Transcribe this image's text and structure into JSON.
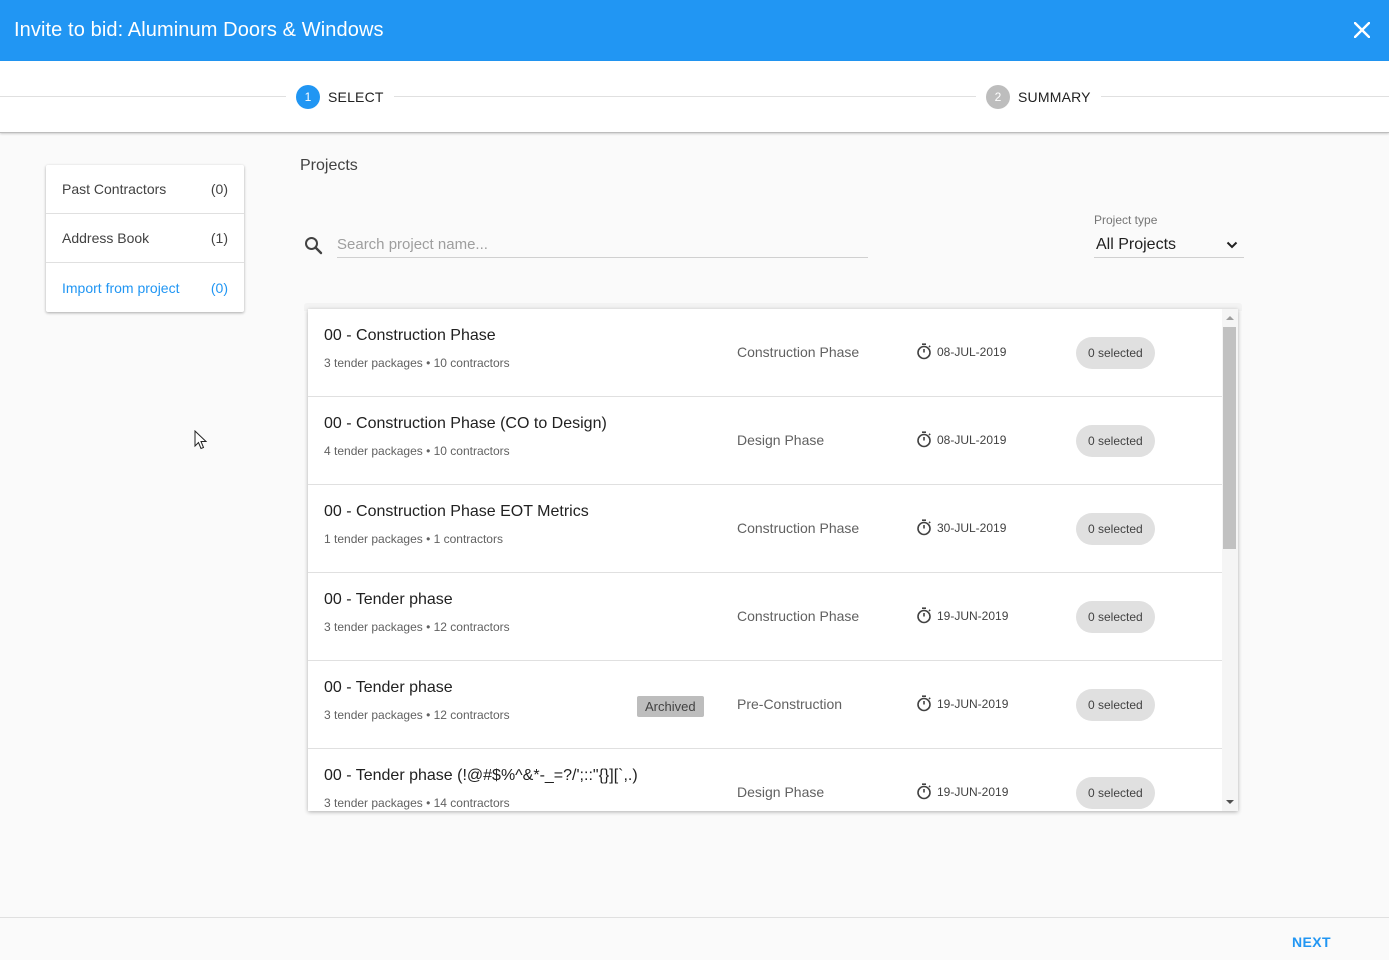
{
  "header": {
    "title": "Invite to bid: Aluminum Doors & Windows",
    "close_icon": "close-icon"
  },
  "stepper": {
    "steps": [
      {
        "number": "1",
        "label": "SELECT",
        "active": true,
        "color": "#2196f3"
      },
      {
        "number": "2",
        "label": "SUMMARY",
        "active": false,
        "color": "#bdbdbd"
      }
    ]
  },
  "sidebar": {
    "items": [
      {
        "label": "Past Contractors",
        "count": "(0)",
        "active": false
      },
      {
        "label": "Address Book",
        "count": "(1)",
        "active": false
      },
      {
        "label": "Import from project",
        "count": "(0)",
        "active": true
      }
    ]
  },
  "main": {
    "title": "Projects",
    "search": {
      "placeholder": "Search project name...",
      "value": "",
      "icon": "search-icon"
    },
    "project_type": {
      "label": "Project type",
      "value": "All Projects",
      "icon": "chevron-down-icon"
    }
  },
  "projects": [
    {
      "name": "00 - Construction Phase",
      "meta": "3 tender packages • 10 contractors",
      "badge": "",
      "phase": "Construction Phase",
      "date": "08-JUL-2019",
      "selected": "0 selected"
    },
    {
      "name": "00 - Construction Phase (CO to Design)",
      "meta": "4 tender packages • 10 contractors",
      "badge": "",
      "phase": "Design Phase",
      "date": "08-JUL-2019",
      "selected": "0 selected"
    },
    {
      "name": "00 - Construction Phase EOT Metrics",
      "meta": "1 tender packages • 1 contractors",
      "badge": "",
      "phase": "Construction Phase",
      "date": "30-JUL-2019",
      "selected": "0 selected"
    },
    {
      "name": "00 - Tender phase",
      "meta": "3 tender packages • 12 contractors",
      "badge": "",
      "phase": "Construction Phase",
      "date": "19-JUN-2019",
      "selected": "0 selected"
    },
    {
      "name": "00 - Tender phase",
      "meta": "3 tender packages • 12 contractors",
      "badge": "Archived",
      "phase": "Pre-Construction",
      "date": "19-JUN-2019",
      "selected": "0 selected"
    },
    {
      "name": "00 - Tender phase (!@#$%^&*-_=?/';::\"{}][`,.)",
      "meta": "3 tender packages • 14 contractors",
      "badge": "",
      "phase": "Design Phase",
      "date": "19-JUN-2019",
      "selected": "0 selected"
    }
  ],
  "footer": {
    "next_label": "NEXT"
  },
  "colors": {
    "primary": "#2196f3",
    "step_inactive": "#bdbdbd"
  }
}
